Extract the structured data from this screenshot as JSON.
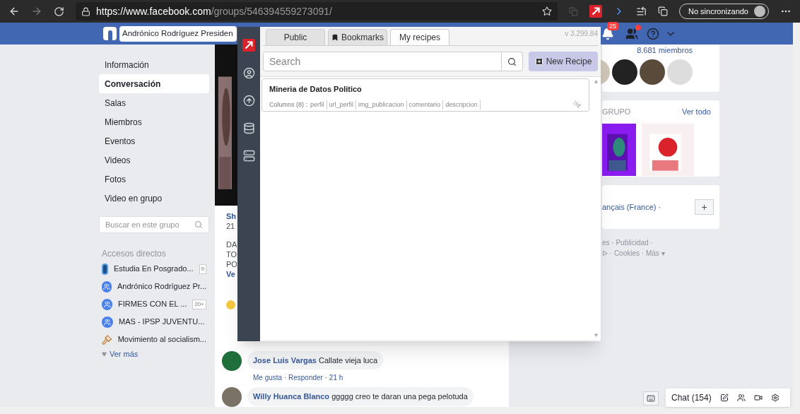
{
  "browser": {
    "url_host": "https://www.facebook.com",
    "url_path": "/groups/546394559273091/",
    "sync_label": "No sincronizando"
  },
  "fb_bar": {
    "search_value": "Andrónico Rodríguez Presiden",
    "notifications": "25"
  },
  "nav": {
    "items": [
      {
        "label": "Información",
        "selected": false
      },
      {
        "label": "Conversación",
        "selected": true
      },
      {
        "label": "Salas",
        "selected": false
      },
      {
        "label": "Miembros",
        "selected": false
      },
      {
        "label": "Eventos",
        "selected": false
      },
      {
        "label": "Videos",
        "selected": false
      },
      {
        "label": "Fotos",
        "selected": false
      },
      {
        "label": "Video en grupo",
        "selected": false
      }
    ],
    "search_placeholder": "Buscar en este grupo",
    "shortcuts_heading": "Accesos directos",
    "shortcuts": [
      {
        "kind": "page",
        "label": "Estudia En Posgrado...",
        "count": "9"
      },
      {
        "kind": "group",
        "label": "Andrónico Rodríguez Pr..."
      },
      {
        "kind": "group",
        "label": "FIRMES CON EL ...",
        "count": "20+"
      },
      {
        "kind": "group",
        "label": "MAS - IPSP JUVENTU..."
      },
      {
        "kind": "gavel",
        "label": "Movimiento al socialism..."
      }
    ],
    "more": "Ver más"
  },
  "post": {
    "fragments": [
      "Sh",
      "21",
      "DA",
      "TO",
      "PO",
      "Ve"
    ],
    "comments": [
      {
        "author": "Jose Luis Vargas",
        "text": "Callate vieja luca",
        "actions": "Me gusta · Responder · 21 h"
      },
      {
        "author": "Willy Huanca Blanco",
        "text": "ggggg creo te daran una pega pelotuda"
      }
    ]
  },
  "right": {
    "members": "8.681 miembros",
    "photos_heading": "GRUPO",
    "see_all": "Ver todo",
    "language": "ançais (France) ·",
    "add": "+",
    "footer": [
      "es · Publicidad ·",
      "ᐅ · Cookies · Más ▾"
    ]
  },
  "chat": {
    "label": "Chat (154)"
  },
  "popup": {
    "version": "v 3.299.84",
    "tabs": [
      {
        "label": "Public",
        "selected": false,
        "kind": "plain"
      },
      {
        "label": "Bookmarks",
        "selected": false,
        "kind": "bookmark"
      },
      {
        "label": "My recipes",
        "selected": true,
        "kind": "plain"
      }
    ],
    "search_placeholder": "Search",
    "new_button": "New Recipe",
    "recipes": [
      {
        "title": "Mineria de Datos Politico",
        "columns_label": "Columns (8) :",
        "columns": [
          "perfil",
          "url_perfil",
          "img_publicacion",
          "comentario",
          "descripcion"
        ]
      }
    ]
  }
}
